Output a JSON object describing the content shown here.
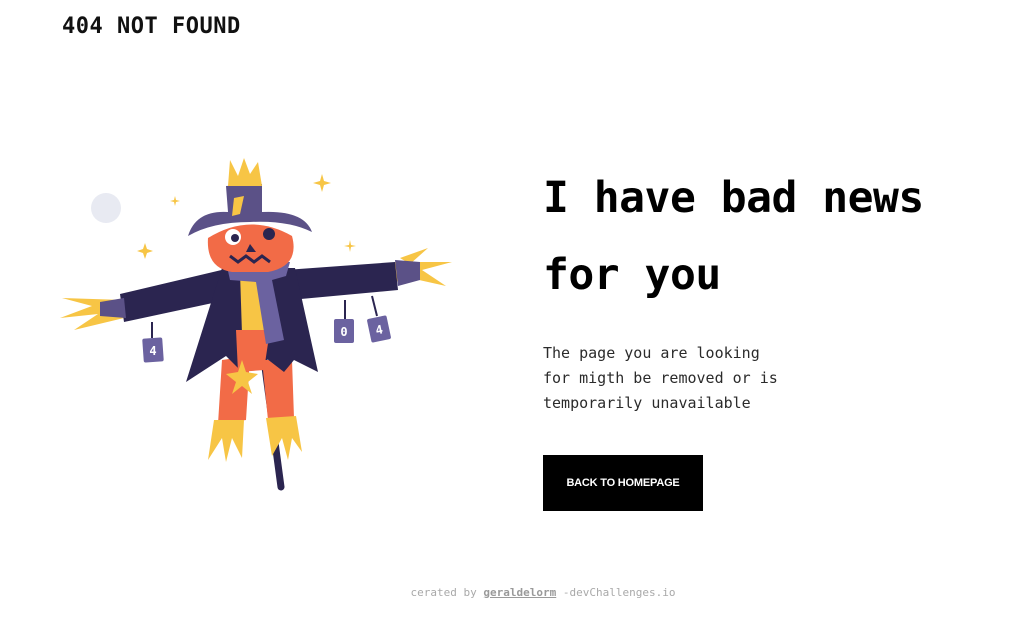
{
  "header": {
    "brand": "404 NOT FOUND"
  },
  "illustration": {
    "can_left_label": "4",
    "can_mid_label": "0",
    "can_right_label": "4",
    "colors": {
      "hat": "#5b5187",
      "coat": "#2b2550",
      "head": "#f26b47",
      "straw": "#f7c545",
      "scarf": "#6b62a0",
      "moon": "#e8eaf2"
    }
  },
  "main": {
    "headline_line1": "I have bad news",
    "headline_line2": "for you",
    "message_line1": "The page you are looking",
    "message_line2": "for migth be removed or is",
    "message_line3": "temporarily unavailable",
    "cta_label": "BACK TO HOMEPAGE"
  },
  "footer": {
    "prefix": "cerated by",
    "author": "geraldelorm",
    "suffix": "-devChallenges.io"
  }
}
